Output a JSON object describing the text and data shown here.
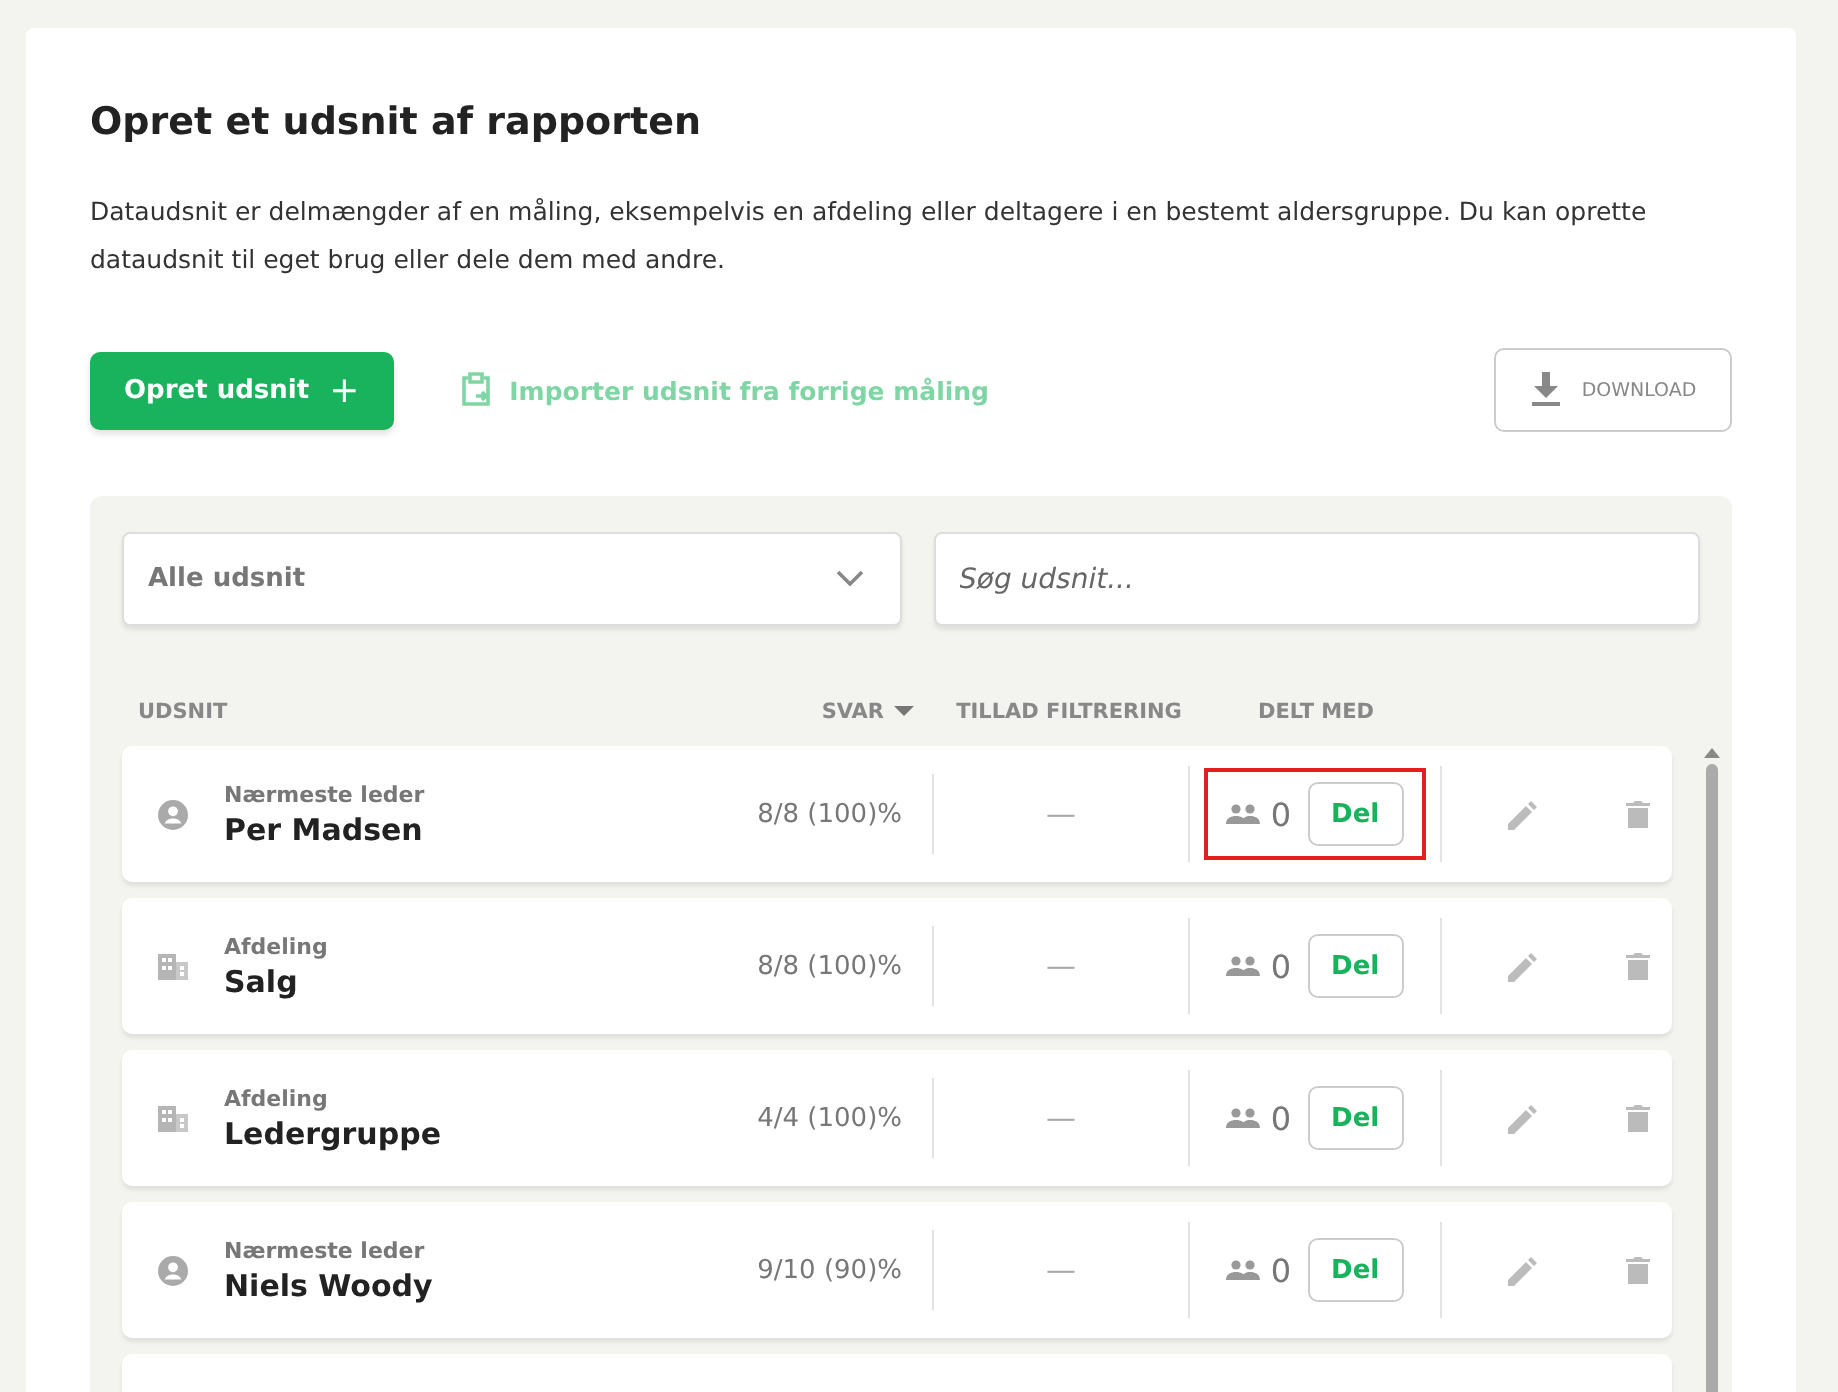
{
  "title": "Opret et udsnit af rapporten",
  "description": "Dataudsnit er delmængder af en måling, eksempelvis en afdeling eller deltagere i en bestemt aldersgruppe. Du kan oprette dataudsnit til eget brug eller dele dem med andre.",
  "actions": {
    "create": "Opret udsnit",
    "create_icon": "+",
    "import": "Importer udsnit fra forrige måling",
    "download": "DOWNLOAD"
  },
  "filter": {
    "value": "Alle udsnit",
    "search_placeholder": "Søg udsnit..."
  },
  "columns": [
    {
      "label": "UDSNIT",
      "sorted": false
    },
    {
      "label": "SVAR",
      "sorted": true
    },
    {
      "label": "TILLAD FILTRERING",
      "sorted": false
    },
    {
      "label": "DELT MED",
      "sorted": false
    }
  ],
  "rows": [
    {
      "kind": "person",
      "type": "Nærmeste leder",
      "name": "Per Madsen",
      "answers": "8/8 (100)%",
      "filtering": "—",
      "shared": "0",
      "share": "Del",
      "highlighted": true
    },
    {
      "kind": "building",
      "type": "Afdeling",
      "name": "Salg",
      "answers": "8/8 (100)%",
      "filtering": "—",
      "shared": "0",
      "share": "Del",
      "highlighted": false
    },
    {
      "kind": "building",
      "type": "Afdeling",
      "name": "Ledergruppe",
      "answers": "4/4 (100)%",
      "filtering": "—",
      "shared": "0",
      "share": "Del",
      "highlighted": false
    },
    {
      "kind": "person",
      "type": "Nærmeste leder",
      "name": "Niels Woody",
      "answers": "9/10 (90)%",
      "filtering": "—",
      "shared": "0",
      "share": "Del",
      "highlighted": false
    },
    {
      "highlighted": false
    }
  ]
}
